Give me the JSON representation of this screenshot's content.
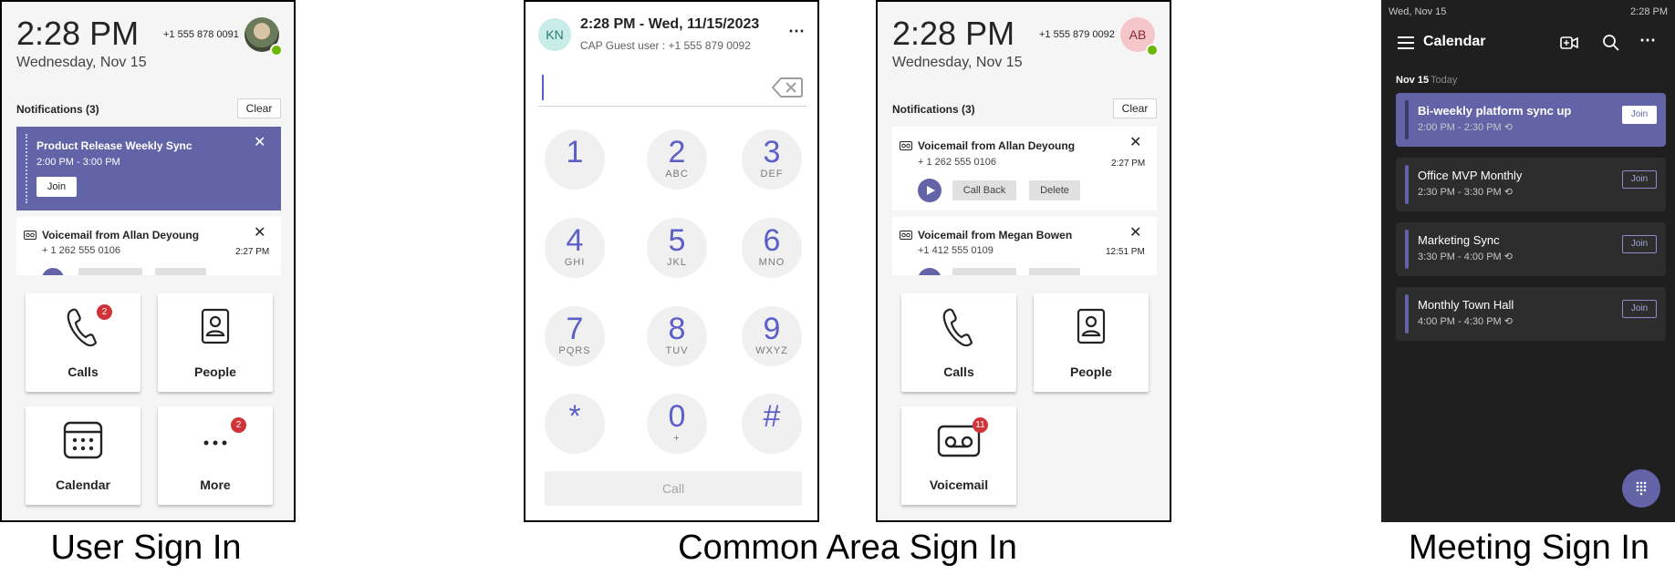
{
  "captions": {
    "user_sign_in": "User Sign In",
    "common_area_sign_in": "Common Area Sign In",
    "meeting_sign_in": "Meeting Sign In"
  },
  "user_panel": {
    "time": "2:28 PM",
    "date": "Wednesday, Nov 15",
    "phone": "+1 555 878 0091",
    "notifications_title": "Notifications (3)",
    "clear_label": "Clear",
    "meeting_card": {
      "title": "Product Release Weekly Sync",
      "time": "2:00 PM - 3:00 PM",
      "join_label": "Join"
    },
    "voicemail_card": {
      "title": "Voicemail from Allan Deyoung",
      "number": "+ 1 262 555 0106",
      "time": "2:27 PM"
    },
    "tiles": [
      {
        "label": "Calls",
        "icon": "phone-icon",
        "badge": "2"
      },
      {
        "label": "People",
        "icon": "people-icon"
      },
      {
        "label": "Calendar",
        "icon": "calendar-icon"
      },
      {
        "label": "More",
        "icon": "more-icon",
        "badge": "2"
      }
    ]
  },
  "dialer_panel": {
    "avatar_initials": "KN",
    "header_title": "2:28 PM - Wed, 11/15/2023",
    "header_subtitle": "CAP Guest user : +1 555 879 0092",
    "input_value": "",
    "keys": [
      {
        "digit": "1",
        "letters": ""
      },
      {
        "digit": "2",
        "letters": "ABC"
      },
      {
        "digit": "3",
        "letters": "DEF"
      },
      {
        "digit": "4",
        "letters": "GHI"
      },
      {
        "digit": "5",
        "letters": "JKL"
      },
      {
        "digit": "6",
        "letters": "MNO"
      },
      {
        "digit": "7",
        "letters": "PQRS"
      },
      {
        "digit": "8",
        "letters": "TUV"
      },
      {
        "digit": "9",
        "letters": "WXYZ"
      },
      {
        "digit": "*",
        "letters": ""
      },
      {
        "digit": "0",
        "letters": "+"
      },
      {
        "digit": "#",
        "letters": ""
      }
    ],
    "call_label": "Call"
  },
  "common_panel": {
    "time": "2:28 PM",
    "date": "Wednesday, Nov 15",
    "phone": "+1 555 879 0092",
    "avatar_initials": "AB",
    "notifications_title": "Notifications (3)",
    "clear_label": "Clear",
    "voicemail_1": {
      "title": "Voicemail from Allan Deyoung",
      "number": "+ 1 262 555 0106",
      "time": "2:27 PM",
      "callback_label": "Call Back",
      "delete_label": "Delete"
    },
    "voicemail_2": {
      "title": "Voicemail from Megan Bowen",
      "number": "+1 412 555 0109",
      "time": "12:51 PM"
    },
    "tiles": [
      {
        "label": "Calls",
        "icon": "phone-icon"
      },
      {
        "label": "People",
        "icon": "people-icon"
      },
      {
        "label": "Voicemail",
        "icon": "voicemail-icon",
        "badge": "11"
      }
    ]
  },
  "meeting_panel": {
    "status_date": "Wed, Nov 15",
    "status_time": "2:28 PM",
    "title": "Calendar",
    "day_label": "Nov 15",
    "today_label": "Today",
    "meetings": [
      {
        "title": "Bi-weekly platform sync up",
        "time": "2:00 PM - 2:30 PM",
        "join_label": "Join",
        "active": true
      },
      {
        "title": "Office MVP Monthly",
        "time": "2:30 PM - 3:30 PM",
        "join_label": "Join"
      },
      {
        "title": "Marketing Sync",
        "time": "3:30 PM - 4:00 PM",
        "join_label": "Join"
      },
      {
        "title": "Monthly Town Hall",
        "time": "4:00 PM - 4:30 PM",
        "join_label": "Join"
      }
    ]
  },
  "colors": {
    "accent": "#6264a7",
    "accent_text": "#5b5fc7",
    "badge": "#d13438",
    "presence": "#6bb700",
    "dark_bg": "#1f1f1f"
  }
}
